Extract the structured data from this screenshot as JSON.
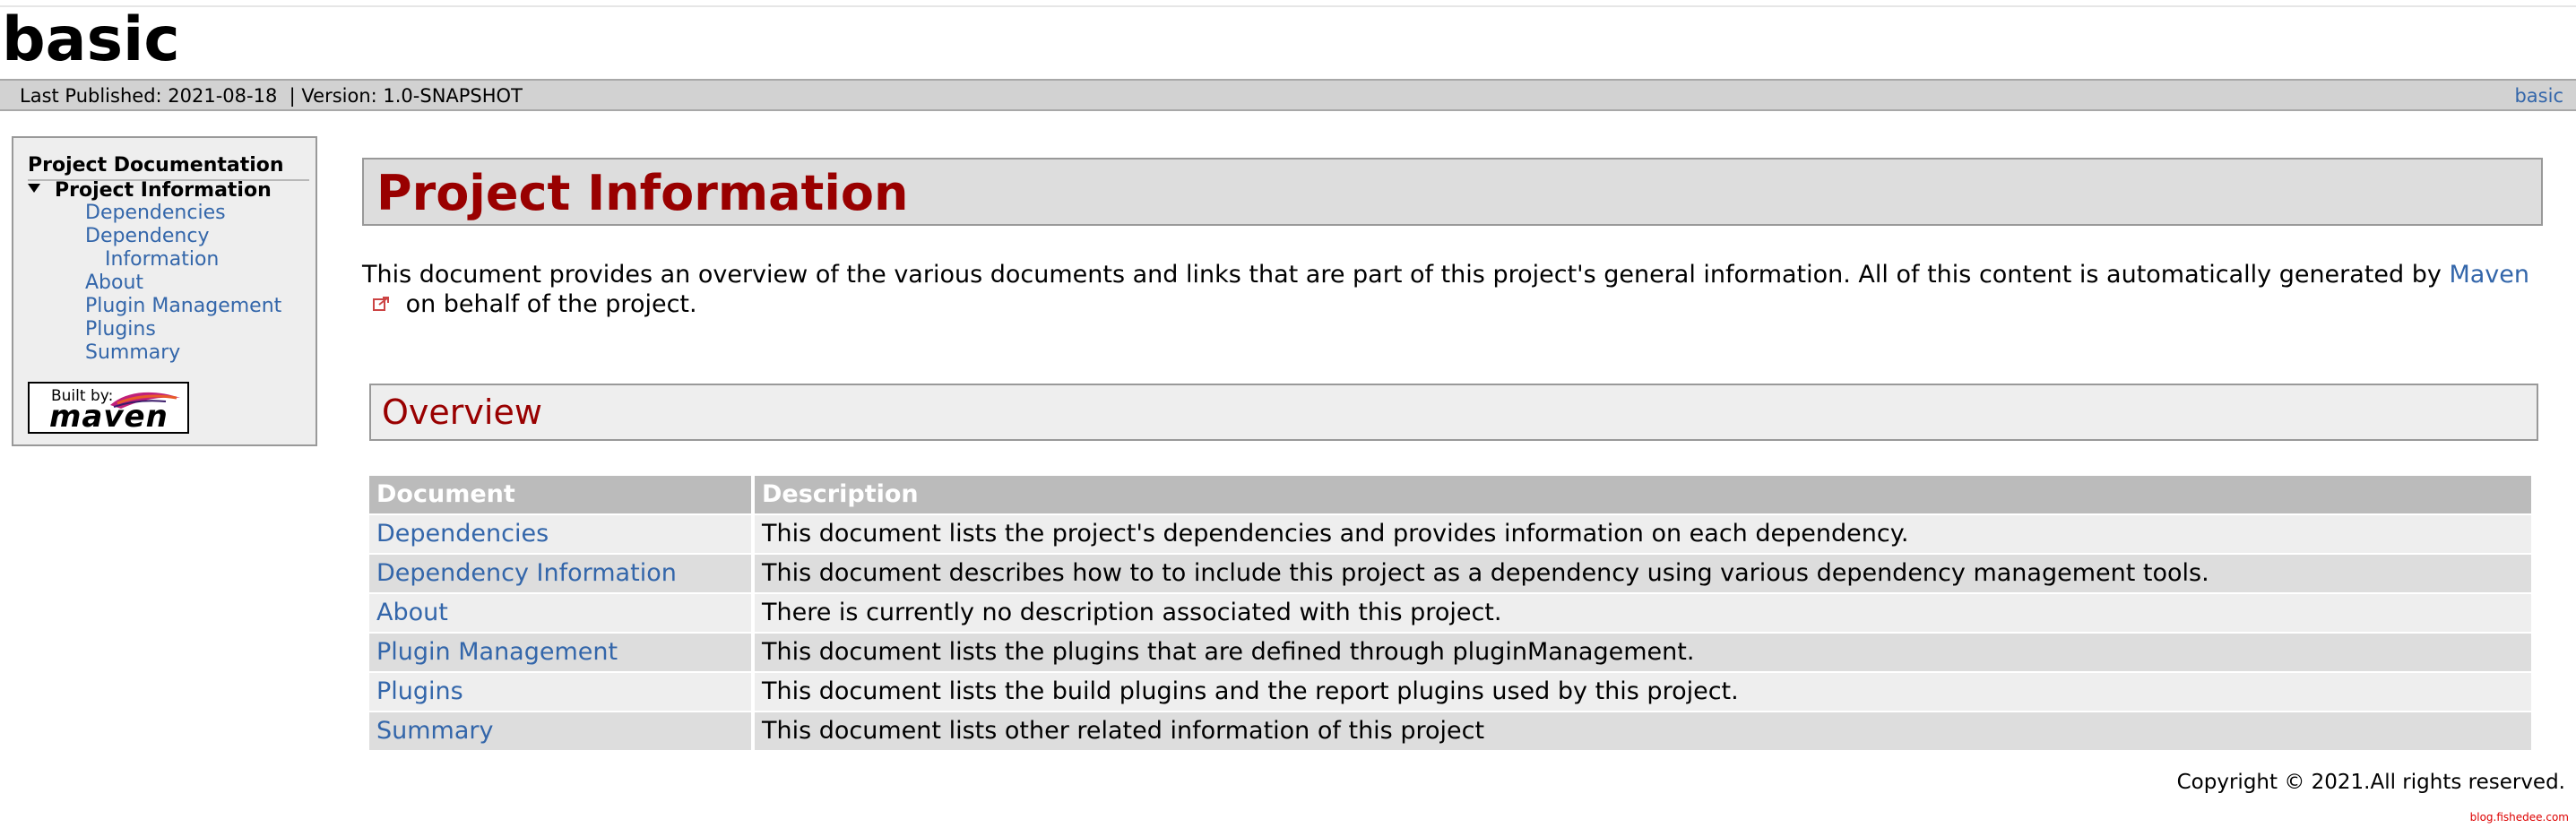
{
  "site": {
    "title": "basic"
  },
  "banner": {
    "published": "Last Published: 2021-08-18  | Version: 1.0-SNAPSHOT",
    "right_link": "basic"
  },
  "nav": {
    "heading": "Project Documentation",
    "current": "Project Information",
    "items": [
      "Dependencies",
      "Dependency",
      "Information",
      "About",
      "Plugin Management",
      "Plugins",
      "Summary"
    ]
  },
  "badge": {
    "built_by": "Built by:",
    "name": "maven"
  },
  "main": {
    "title": "Project Information",
    "intro_before": "This document provides an overview of the various documents and links that are part of this project's general information. All of this content is automatically generated by ",
    "intro_link": "Maven",
    "intro_after": " on behalf of the project.",
    "overview_title": "Overview",
    "table": {
      "headers": [
        "Document",
        "Description"
      ],
      "rows": [
        [
          "Dependencies",
          "This document lists the project's dependencies and provides information on each dependency."
        ],
        [
          "Dependency Information",
          "This document describes how to to include this project as a dependency using various dependency management tools."
        ],
        [
          "About",
          "There is currently no description associated with this project."
        ],
        [
          "Plugin Management",
          "This document lists the plugins that are defined through pluginManagement."
        ],
        [
          "Plugins",
          "This document lists the build plugins and the report plugins used by this project."
        ],
        [
          "Summary",
          "This document lists other related information of this project"
        ]
      ]
    }
  },
  "footer": {
    "copyright": "Copyright © 2021.All rights reserved.",
    "watermark": "blog.fishedee.com"
  },
  "colors": {
    "link": "#3366aa",
    "heading": "#990000",
    "banner": "#d2d2d2"
  }
}
